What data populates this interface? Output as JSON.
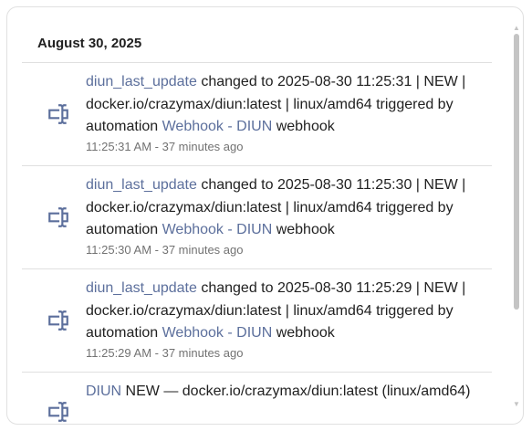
{
  "date_header": "August 30, 2025",
  "entries": [
    {
      "entity": "diun_last_update",
      "text1": " changed to 2025-08-30 11:25:31 | NEW | docker.io/crazymax/diun:latest | linux/amd64 triggered by automation ",
      "automation": "Webhook - DIUN",
      "text2": " webhook",
      "time": "11:25:31 AM - 37 minutes ago",
      "icon": "form-textbox-icon"
    },
    {
      "entity": "diun_last_update",
      "text1": " changed to 2025-08-30 11:25:30 | NEW | docker.io/crazymax/diun:latest | linux/amd64 triggered by automation ",
      "automation": "Webhook - DIUN",
      "text2": " webhook",
      "time": "11:25:30 AM - 37 minutes ago",
      "icon": "form-textbox-icon"
    },
    {
      "entity": "diun_last_update",
      "text1": " changed to 2025-08-30 11:25:29 | NEW | docker.io/crazymax/diun:latest | linux/amd64 triggered by automation ",
      "automation": "Webhook - DIUN",
      "text2": " webhook",
      "time": "11:25:29 AM - 37 minutes ago",
      "icon": "form-textbox-icon"
    },
    {
      "entity": "DIUN",
      "text1": " NEW — docker.io/crazymax/diun:latest (linux/amd64)",
      "icon": "form-textbox-icon"
    }
  ],
  "colors": {
    "link": "#5c6f9c",
    "text": "#212121",
    "secondary": "#727272",
    "icon": "#5c6f9c",
    "divider": "#e0e0e0",
    "scrollbar": "#c4c4c4"
  }
}
